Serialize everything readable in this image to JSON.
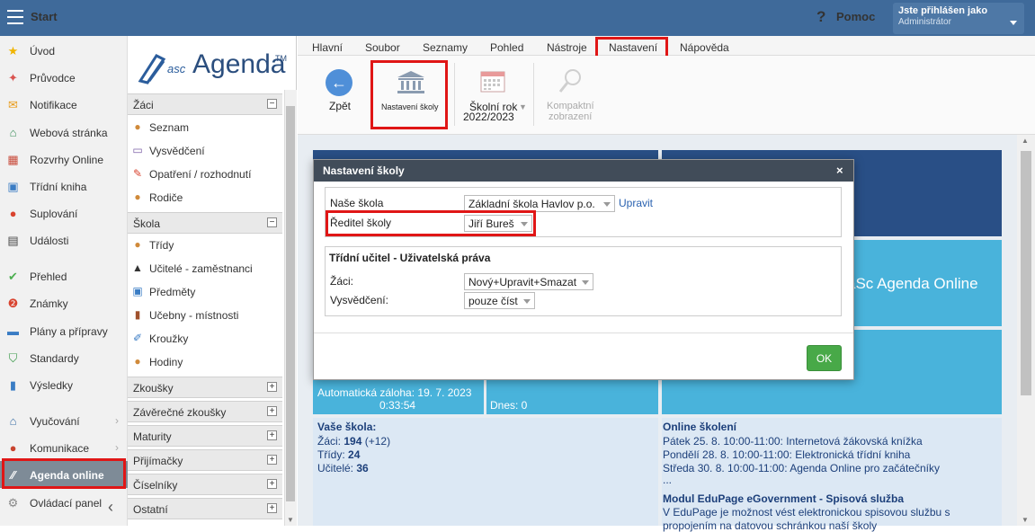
{
  "topbar": {
    "start": "Start",
    "help_glyph": "?",
    "help": "Pomoc",
    "user_line1": "Jste přihlášen jako",
    "user_line2": "Administrátor"
  },
  "leftnav": [
    {
      "label": "Úvod",
      "icon": "star-icon"
    },
    {
      "label": "Průvodce",
      "icon": "wand-icon"
    },
    {
      "label": "Notifikace",
      "icon": "envelope-icon"
    },
    {
      "label": "Webová stránka",
      "icon": "home-icon"
    },
    {
      "label": "Rozvrhy Online",
      "icon": "grid-icon"
    },
    {
      "label": "Třídní kniha",
      "icon": "book-icon"
    },
    {
      "label": "Suplování",
      "icon": "person-icon"
    },
    {
      "label": "Události",
      "icon": "calendar-icon"
    },
    {
      "label": "Přehled",
      "icon": "check-icon"
    },
    {
      "label": "Známky",
      "icon": "grade-icon"
    },
    {
      "label": "Plány a přípravy",
      "icon": "briefcase-icon"
    },
    {
      "label": "Standardy",
      "icon": "shield-icon"
    },
    {
      "label": "Výsledky",
      "icon": "bar-chart-icon"
    },
    {
      "label": "Vyučování",
      "icon": "classroom-icon"
    },
    {
      "label": "Komunikace",
      "icon": "chat-icon"
    },
    {
      "label": "Agenda online",
      "icon": "agenda-icon"
    },
    {
      "label": "Ovládací panel",
      "icon": "gear-icon"
    }
  ],
  "logo": {
    "asc": "asc",
    "agenda": "Agenda",
    "tm": "TM"
  },
  "tree": {
    "zaci": {
      "title": "Žáci",
      "toggle": "−",
      "items": [
        "Seznam",
        "Vysvědčení",
        "Opatření / rozhodnutí",
        "Rodiče"
      ]
    },
    "skola": {
      "title": "Škola",
      "toggle": "−",
      "items": [
        "Třídy",
        "Učitelé - zaměstnanci",
        "Předměty",
        "Učebny - místnosti",
        "Kroužky",
        "Hodiny"
      ]
    },
    "collapsed": [
      "Zkoušky",
      "Závěrečné zkoušky",
      "Maturity",
      "Přijímačky",
      "Číselníky",
      "Ostatní"
    ],
    "expand_toggle": "+"
  },
  "menu": [
    "Hlavní",
    "Soubor",
    "Seznamy",
    "Pohled",
    "Nástroje",
    "Nastavení",
    "Nápověda"
  ],
  "ribbon": {
    "back": "Zpět",
    "school_settings": "Nastavení školy",
    "school_year_1": "Školní rok",
    "school_year_2": "2022/2023",
    "compact_1": "Kompaktní",
    "compact_2": "zobrazení"
  },
  "tiles": {
    "agenda_online": "aSc Agenda Online",
    "backup_1": "Automatická záloha: 19. 7. 2023",
    "backup_2": "0:33:54",
    "today": "Dnes: 0"
  },
  "school_panel": {
    "title": "Vaše škola:",
    "students_label": "Žáci:",
    "students": "194",
    "students_delta": "(+12)",
    "classes_label": "Třídy:",
    "classes": "24",
    "teachers_label": "Učitelé:",
    "teachers": "36"
  },
  "news_panel": {
    "title": "Online školení",
    "items": [
      "Pátek 25. 8. 10:00-11:00: Internetová žákovská knížka",
      "Pondělí 28. 8. 10:00-11:00: Elektronická třídní kniha",
      "Středa 30. 8. 10:00-11:00: Agenda Online pro začátečníky"
    ],
    "more": "...",
    "module_title": "Modul EduPage eGovernment - Spisová služba",
    "module_line1": "V EduPage je možnost vést elektronickou spisovou službu s",
    "module_line2": "propojením na datovou schránkou naší školy"
  },
  "dialog": {
    "title": "Nastavení školy",
    "close": "×",
    "our_school_label": "Naše škola",
    "our_school_value": "Základní škola Havlov p.o.",
    "edit": "Upravit",
    "director_label": "Ředitel školy",
    "director_value": "Jiří Bureš",
    "rights_title": "Třídní učitel - Uživatelská práva",
    "students_label": "Žáci:",
    "students_value": "Nový+Upravit+Smazat",
    "report_label": "Vysvědčení:",
    "report_value": "pouze číst",
    "ok": "OK"
  },
  "colors": {
    "topbar": "#3f6a9a",
    "tile_dark": "#294f86",
    "tile_light": "#49b3db",
    "highlight": "#e01616",
    "ok": "#48a948"
  }
}
